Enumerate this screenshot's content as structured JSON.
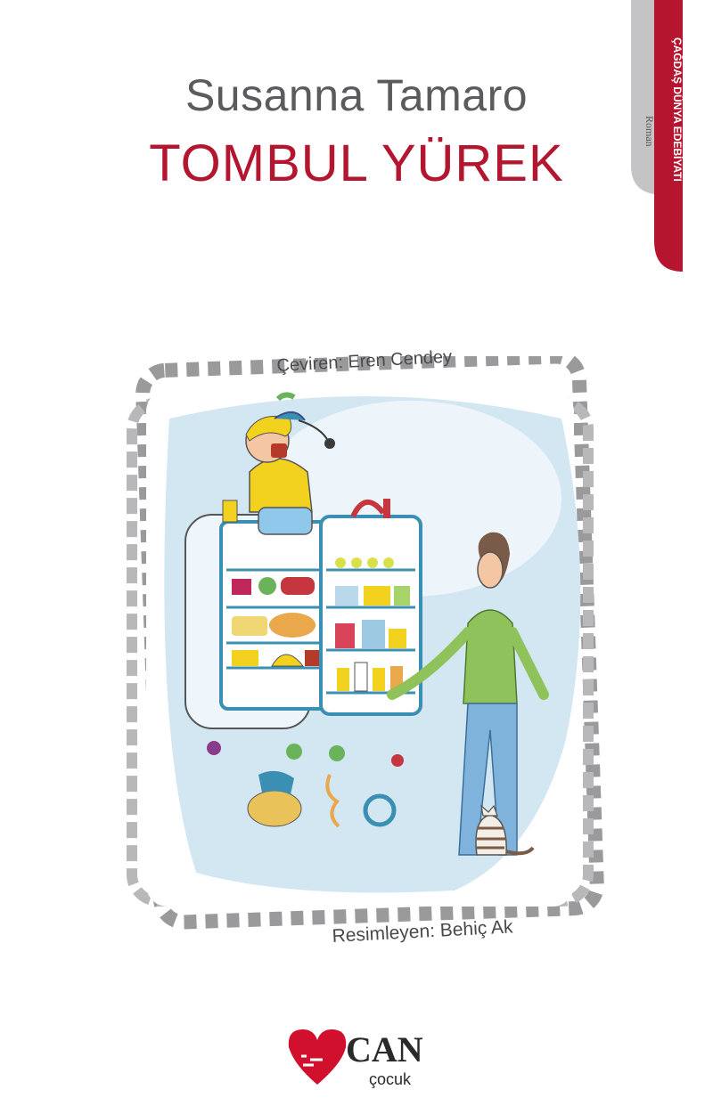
{
  "cover": {
    "author": "Susanna Tamaro",
    "title": "TOMBUL YÜREK",
    "translator_credit": "Çeviren: Eren Cendey",
    "illustrator_credit": "Resimleyen: Behiç Ak"
  },
  "series": {
    "name": "ÇAĞDAŞ DÜNYA EDEBİYATI",
    "genre": "Roman"
  },
  "publisher": {
    "name": "CAN",
    "imprint": "çocuk"
  },
  "colors": {
    "title_red": "#b3162f",
    "author_gray": "#5b5b5d",
    "tab_gray": "#b9b9bb",
    "sky_blue": "#d3e7f3"
  }
}
